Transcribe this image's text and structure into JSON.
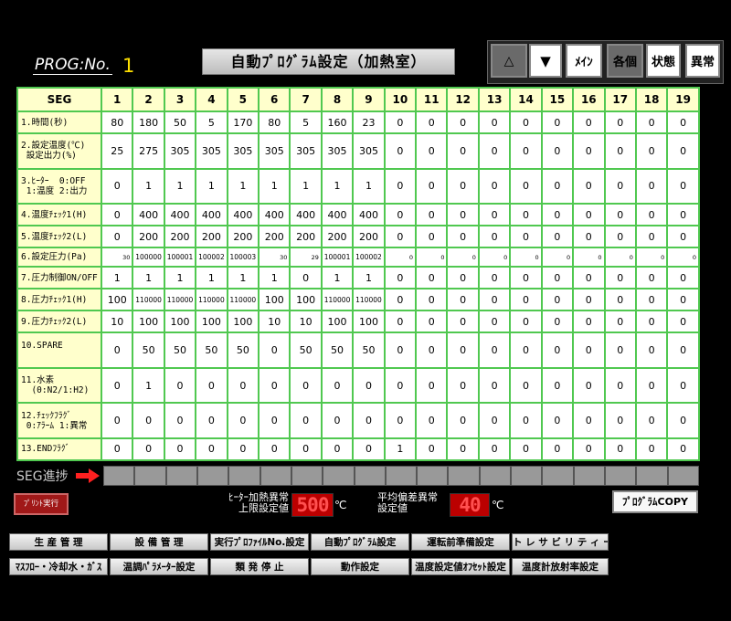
{
  "header": {
    "prog_label": "PROG:No.",
    "prog_number": "1",
    "title": "自動ﾌﾟﾛｸﾞﾗﾑ設定（加熱室）"
  },
  "nav": {
    "up_label": "△",
    "down_label": "▼",
    "main_label": "ﾒｲﾝ",
    "individual_label": "各個",
    "status_label": "状態",
    "alarm_label": "異常"
  },
  "table": {
    "corner": "SEG",
    "columns": [
      "1",
      "2",
      "3",
      "4",
      "5",
      "6",
      "7",
      "8",
      "9",
      "10",
      "11",
      "12",
      "13",
      "14",
      "15",
      "16",
      "17",
      "18",
      "19"
    ],
    "rows": [
      {
        "label": "1.時間(秒)",
        "values": [
          "80",
          "180",
          "50",
          "5",
          "170",
          "80",
          "5",
          "160",
          "23",
          "0",
          "0",
          "0",
          "0",
          "0",
          "0",
          "0",
          "0",
          "0",
          "0"
        ]
      },
      {
        "label": "2.設定温度(℃)\n 設定出力(%)",
        "values": [
          "25",
          "275",
          "305",
          "305",
          "305",
          "305",
          "305",
          "305",
          "305",
          "0",
          "0",
          "0",
          "0",
          "0",
          "0",
          "0",
          "0",
          "0",
          "0"
        ]
      },
      {
        "label": "3.ﾋｰﾀｰ  0:OFF\n 1:温度 2:出力",
        "values": [
          "0",
          "1",
          "1",
          "1",
          "1",
          "1",
          "1",
          "1",
          "1",
          "0",
          "0",
          "0",
          "0",
          "0",
          "0",
          "0",
          "0",
          "0",
          "0"
        ]
      },
      {
        "label": "4.温度ﾁｪｯｸ1(H)",
        "values": [
          "0",
          "400",
          "400",
          "400",
          "400",
          "400",
          "400",
          "400",
          "400",
          "0",
          "0",
          "0",
          "0",
          "0",
          "0",
          "0",
          "0",
          "0",
          "0"
        ]
      },
      {
        "label": "5.温度ﾁｪｯｸ2(L)",
        "values": [
          "0",
          "200",
          "200",
          "200",
          "200",
          "200",
          "200",
          "200",
          "200",
          "0",
          "0",
          "0",
          "0",
          "0",
          "0",
          "0",
          "0",
          "0",
          "0"
        ]
      },
      {
        "label": "6.設定圧力(Pa)",
        "values": [
          "30",
          "100000",
          "100001",
          "100002",
          "100003",
          "30",
          "29",
          "100001",
          "100002",
          "0",
          "0",
          "0",
          "0",
          "0",
          "0",
          "0",
          "0",
          "0",
          "0"
        ]
      },
      {
        "label": "7.圧力制御ON/OFF",
        "values": [
          "1",
          "1",
          "1",
          "1",
          "1",
          "1",
          "0",
          "1",
          "1",
          "0",
          "0",
          "0",
          "0",
          "0",
          "0",
          "0",
          "0",
          "0",
          "0"
        ]
      },
      {
        "label": "8.圧力ﾁｪｯｸ1(H)",
        "values": [
          "100",
          "110000",
          "110000",
          "110000",
          "110000",
          "100",
          "100",
          "110000",
          "110000",
          "0",
          "0",
          "0",
          "0",
          "0",
          "0",
          "0",
          "0",
          "0",
          "0"
        ]
      },
      {
        "label": "9.圧力ﾁｪｯｸ2(L)",
        "values": [
          "10",
          "100",
          "100",
          "100",
          "100",
          "10",
          "10",
          "100",
          "100",
          "0",
          "0",
          "0",
          "0",
          "0",
          "0",
          "0",
          "0",
          "0",
          "0"
        ]
      },
      {
        "label": "10.SPARE\n ",
        "values": [
          "0",
          "50",
          "50",
          "50",
          "50",
          "0",
          "50",
          "50",
          "50",
          "0",
          "0",
          "0",
          "0",
          "0",
          "0",
          "0",
          "0",
          "0",
          "0"
        ]
      },
      {
        "label": "11.水素\n  (0:N2/1:H2)",
        "values": [
          "0",
          "1",
          "0",
          "0",
          "0",
          "0",
          "0",
          "0",
          "0",
          "0",
          "0",
          "0",
          "0",
          "0",
          "0",
          "0",
          "0",
          "0",
          "0"
        ]
      },
      {
        "label": "12.ﾁｪｯｸﾌﾗｸﾞ\n 0:ｱﾗｰﾑ 1:異常",
        "values": [
          "0",
          "0",
          "0",
          "0",
          "0",
          "0",
          "0",
          "0",
          "0",
          "0",
          "0",
          "0",
          "0",
          "0",
          "0",
          "0",
          "0",
          "0",
          "0"
        ]
      },
      {
        "label": "13.ENDﾌﾗｸﾞ",
        "values": [
          "0",
          "0",
          "0",
          "0",
          "0",
          "0",
          "0",
          "0",
          "0",
          "1",
          "0",
          "0",
          "0",
          "0",
          "0",
          "0",
          "0",
          "0",
          "0"
        ]
      }
    ]
  },
  "progress": {
    "label": "SEG進捗"
  },
  "print_button": "ﾌﾟﾘﾝﾄ実行",
  "heater_limit": {
    "label_line1": "ﾋｰﾀｰ加熱異常",
    "label_line2": "上限設定値",
    "value": "500",
    "unit": "℃"
  },
  "avg_deviation": {
    "label_line1": "平均偏差異常",
    "label_line2": "設定値",
    "value": "40",
    "unit": "℃"
  },
  "copy_button": "ﾌﾟﾛｸﾞﾗﾑCOPY",
  "menu": {
    "row1": [
      "生 産 管 理",
      "設 備 管 理",
      "実行ﾌﾟﾛﾌｧｲﾙNo.設定",
      "自動ﾌﾟﾛｸﾞﾗﾑ設定",
      "運転前準備設定",
      "ト レ サ ビ リ テ ィ ー"
    ],
    "row2": [
      "ﾏｽﾌﾛｰ・冷却水・ｶﾞｽ",
      "温調ﾊﾟﾗﾒｰﾀｰ設定",
      "類 発 停 止",
      "動作設定",
      "温度設定値ｵﾌｾｯﾄ設定",
      "温度計放射率設定"
    ]
  },
  "colors": {
    "grid_border": "#50c850",
    "label_bg": "#ffffcc",
    "segment_red": "#ff5050",
    "prog_number": "#ffe000"
  }
}
